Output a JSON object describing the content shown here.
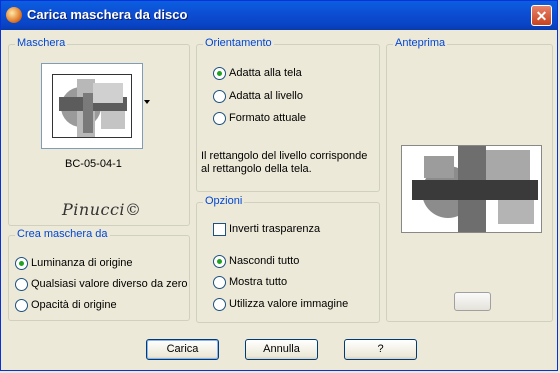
{
  "window": {
    "title": "Carica maschera da disco",
    "close_glyph": "✕"
  },
  "mask_group": {
    "label": "Maschera",
    "mask_name": "BC-05-04-1",
    "watermark": "Pinucci©"
  },
  "orientation_group": {
    "label": "Orientamento",
    "options": [
      {
        "label": "Adatta alla tela",
        "selected": true
      },
      {
        "label": "Adatta al livello",
        "selected": false
      },
      {
        "label": "Formato attuale",
        "selected": false
      }
    ],
    "description": "Il rettangolo del livello corrisponde al rettangolo della tela."
  },
  "create_group": {
    "label": "Crea maschera da",
    "options": [
      {
        "label": "Luminanza di origine",
        "selected": true
      },
      {
        "label": "Qualsiasi valore diverso da zero",
        "selected": false
      },
      {
        "label": "Opacità di origine",
        "selected": false
      }
    ]
  },
  "options_group": {
    "label": "Opzioni",
    "invert_label": "Inverti trasparenza",
    "invert_checked": false,
    "options": [
      {
        "label": "Nascondi tutto",
        "selected": true
      },
      {
        "label": "Mostra tutto",
        "selected": false
      },
      {
        "label": "Utilizza valore immagine",
        "selected": false
      }
    ]
  },
  "preview_group": {
    "label": "Anteprima"
  },
  "buttons": {
    "load": "Carica",
    "cancel": "Annulla",
    "help": "?"
  },
  "icons": {
    "app": "psp-app-icon",
    "close": "close-icon",
    "dropdown": "dropdown-arrow-icon"
  }
}
